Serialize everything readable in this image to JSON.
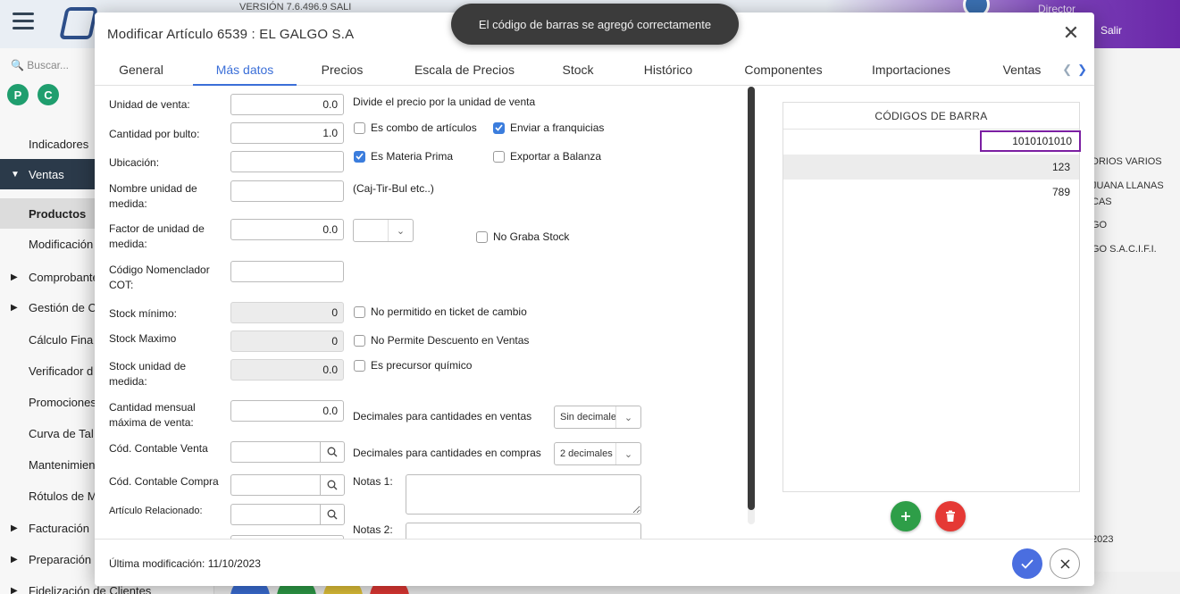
{
  "topbar": {
    "version": "VERSIÓN 7.6.496.9 SALI",
    "user_role": "Director",
    "logout_label": "Salir"
  },
  "sidebar": {
    "search_placeholder": "Buscar...",
    "chips": [
      "P",
      "C"
    ],
    "items": [
      {
        "label": "Indicadores"
      },
      {
        "label": "Ventas"
      },
      {
        "label": "Productos"
      },
      {
        "label": "Modificación"
      },
      {
        "label": "Comprobantes"
      },
      {
        "label": "Gestión de C"
      },
      {
        "label": "Cálculo Fina"
      },
      {
        "label": "Verificador d"
      },
      {
        "label": "Promociones"
      },
      {
        "label": "Curva de Tal"
      },
      {
        "label": "Mantenimien"
      },
      {
        "label": "Rótulos de M"
      },
      {
        "label": "Facturación"
      },
      {
        "label": "Preparación"
      },
      {
        "label": "Fidelización de Clientes"
      }
    ]
  },
  "background_list": [
    "DRIOS VARIOS",
    "JUANA LLANAS",
    "CAS",
    "GO",
    "GO S.A.C.I.F.I.",
    "2023"
  ],
  "toast": {
    "message": "El código de barras se agregó correctamente"
  },
  "modal": {
    "title": "Modificar Artículo 6539 : EL GALGO S.A",
    "tabs": [
      {
        "label": "General"
      },
      {
        "label": "Más datos"
      },
      {
        "label": "Precios"
      },
      {
        "label": "Escala de Precios"
      },
      {
        "label": "Stock"
      },
      {
        "label": "Histórico"
      },
      {
        "label": "Componentes"
      },
      {
        "label": "Importaciones"
      },
      {
        "label": "Ventas"
      }
    ],
    "active_tab": "Más datos",
    "fields": {
      "unidad_venta": {
        "label": "Unidad de venta:",
        "value": "0.0"
      },
      "cantidad_bulto": {
        "label": "Cantidad por bulto:",
        "value": "1.0"
      },
      "ubicacion": {
        "label": "Ubicación:",
        "value": ""
      },
      "nombre_unidad": {
        "label": "Nombre unidad de medida:",
        "value": ""
      },
      "factor_unidad": {
        "label": "Factor de unidad de medida:",
        "value": "0.0"
      },
      "codigo_nomenclador": {
        "label": "Código Nomenclador COT:",
        "value": ""
      },
      "stock_minimo": {
        "label": "Stock mínimo:",
        "value": "0"
      },
      "stock_maximo": {
        "label": "Stock Maximo",
        "value": "0"
      },
      "stock_unidad": {
        "label": "Stock unidad de medida:",
        "value": "0.0"
      },
      "cantidad_mensual": {
        "label": "Cantidad mensual máxima de venta:",
        "value": "0.0"
      },
      "cod_contable_venta": {
        "label": "Cód. Contable Venta",
        "value": ""
      },
      "cod_contable_compra": {
        "label": "Cód. Contable Compra",
        "value": ""
      },
      "articulo_relacionado": {
        "label": "Artículo Relacionado:",
        "value": ""
      }
    },
    "hints": {
      "divide_precio": "Divide el precio por la unidad de venta",
      "caj_tir": "(Caj-Tir-Bul etc..)"
    },
    "checkboxes": {
      "es_combo": {
        "label": "Es combo de artículos",
        "checked": false
      },
      "enviar_franquicias": {
        "label": "Enviar a franquicias",
        "checked": true
      },
      "es_materia_prima": {
        "label": "Es Materia Prima",
        "checked": true
      },
      "exportar_balanza": {
        "label": "Exportar a Balanza",
        "checked": false
      },
      "no_graba_stock": {
        "label": "No Graba Stock",
        "checked": false
      },
      "no_permitido_ticket": {
        "label": "No permitido en ticket de cambio",
        "checked": false
      },
      "no_permite_descuento": {
        "label": "No Permite Descuento en Ventas",
        "checked": false
      },
      "es_precursor": {
        "label": "Es precursor químico",
        "checked": false
      }
    },
    "decimales": {
      "ventas": {
        "label": "Decimales para cantidades en ventas",
        "value": "Sin decimales"
      },
      "compras": {
        "label": "Decimales para cantidades en compras",
        "value": "2 decimales"
      }
    },
    "notas": {
      "notas1_label": "Notas 1:",
      "notas2_label": "Notas 2:"
    },
    "barcodes": {
      "header": "CÓDIGOS DE BARRA",
      "rows": [
        "1010101010",
        "123",
        "789"
      ]
    },
    "footer": {
      "last_modified": "Última modificación: 11/10/2023"
    }
  },
  "colors": {
    "accent": "#3b6fd8",
    "checkbox": "#3b7ddd",
    "add_button": "#2e9e48",
    "delete_button": "#e53935",
    "confirm_button": "#4a6ee0",
    "edit_border": "#7b1fa2"
  }
}
